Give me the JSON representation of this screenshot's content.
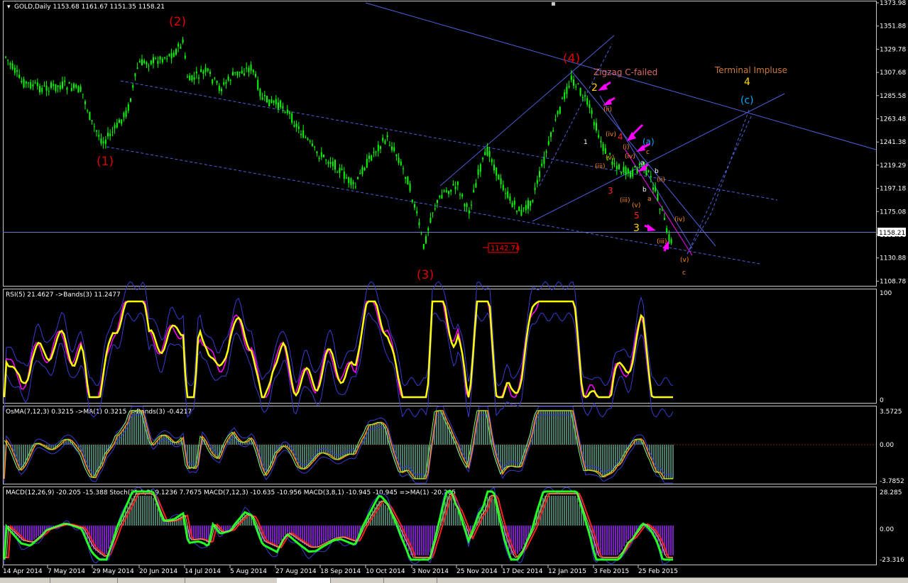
{
  "main": {
    "header": "GOLD,Daily  1153.68 1161.67 1151.35 1158.21",
    "current_price": "1158.21",
    "low_marker": "1142.74",
    "price_axis": [
      "1373.98",
      "1351.88",
      "1329.78",
      "1307.68",
      "1285.58",
      "1263.48",
      "1241.38",
      "1219.29",
      "1197.18",
      "1175.08",
      "1152.98",
      "1130.88",
      "1108.78"
    ],
    "labels": {
      "w1": "(1)",
      "w2": "(2)",
      "w3": "(3)",
      "w4": "(4)",
      "zigzag": "Zigzag C-failed",
      "terminal": "Terminal Impluse",
      "terminal_num": "4",
      "c_blue": "(c)",
      "a_blue": "(a)",
      "two_yellow": "2",
      "three_yellow": "3",
      "three_red": "3",
      "four_red": "4",
      "five_red": "5",
      "one_small": "1",
      "i_small": "(i)",
      "ii_small": "(ii)",
      "iii_small": "(iii)",
      "iv_small": "(iv)",
      "v_small": "(v)",
      "c_small": "c",
      "a_small": "a",
      "b_small": "b"
    }
  },
  "rsi": {
    "header": "RSI(5) 21.4627  ->Bands(3) 11.2477",
    "axis": [
      "100",
      "0"
    ]
  },
  "osma": {
    "header": "OsMA(7,12,3) 0.3215  ->MA(1) 0.3215  ->Bands(3) -0.4217",
    "axis": [
      "3.5725",
      "0.00",
      "-3.7852"
    ]
  },
  "macd": {
    "header": "MACD(12,26,9) -20.205 -15.388  Stoch(21,3,3) 9.1236 7.7675  MACD(7,12,3) -10.635 -10.956  MACD(3,8,1) -10.945 -10.945  =>MA(1) -20.205",
    "axis": [
      "28.285",
      "0.00",
      "-23.316"
    ]
  },
  "dates": [
    "14 Apr 2014",
    "7 May 2014",
    "29 May 2014",
    "20 Jun 2014",
    "14 Jul 2014",
    "5 Aug 2014",
    "27 Aug 2014",
    "18 Sep 2014",
    "10 Oct 2014",
    "3 Nov 2014",
    "25 Nov 2014",
    "17 Dec 2014",
    "12 Jan 2015",
    "3 Feb 2015",
    "25 Feb 2015"
  ],
  "colors": {
    "candle": "#00ff00",
    "wave_red": "#ff0000",
    "channel": "#4f5fd8",
    "rsi": "#ffff00",
    "magenta": "#ff00ff",
    "orange": "#ff8c1a",
    "macd_green": "#22ff22",
    "macd_red": "#ff2020",
    "hist": "#4a7a6a"
  }
}
